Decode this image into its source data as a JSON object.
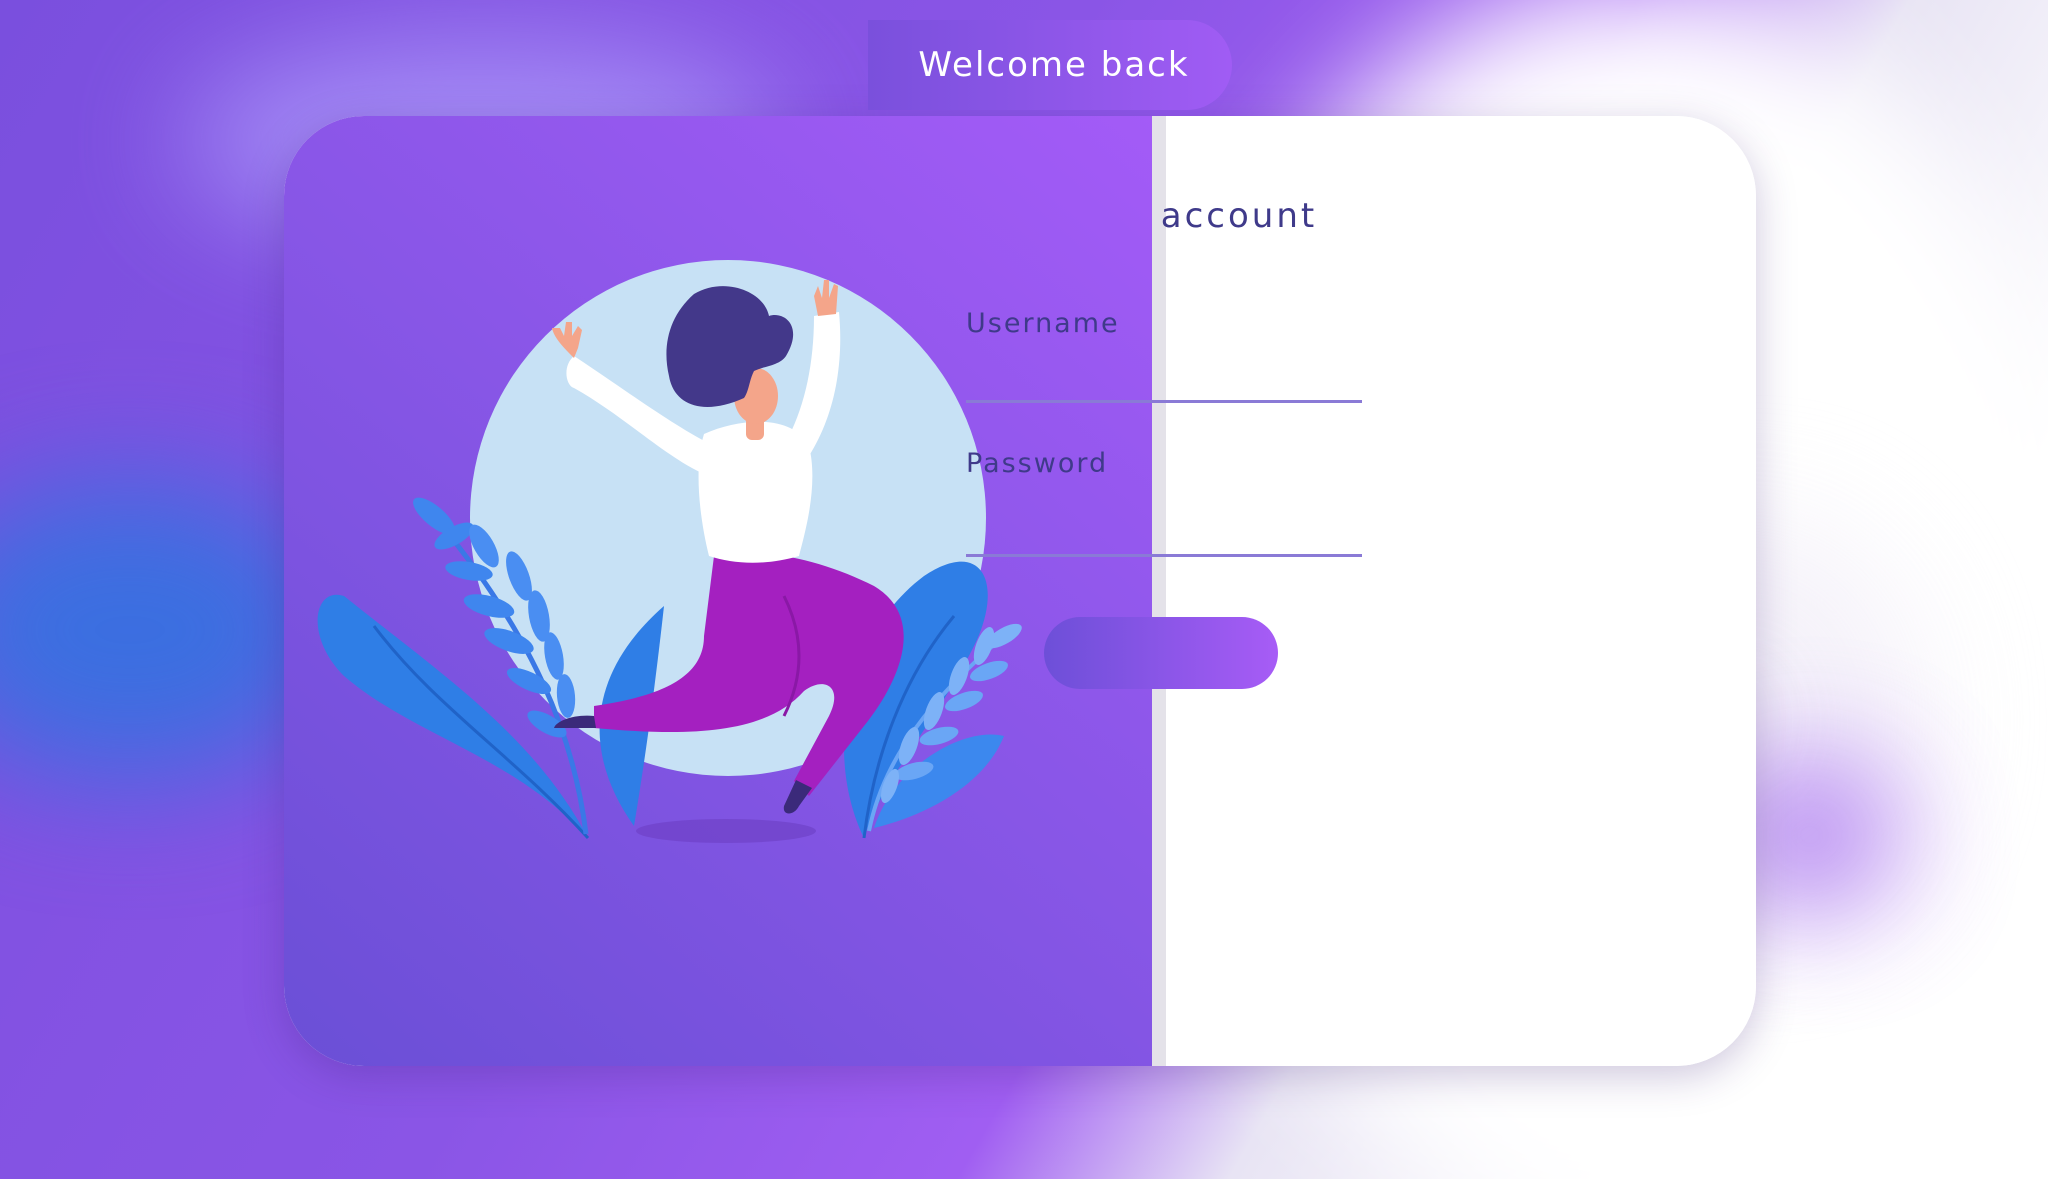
{
  "header": {
    "welcome": "Welcome back"
  },
  "form": {
    "title": "account",
    "username_label": "Username",
    "username_value": "",
    "password_label": "Password",
    "password_value": "",
    "submit_label": ""
  },
  "colors": {
    "accent_start": "#6d4fd8",
    "accent_end": "#a75cf6",
    "text": "#3f3a8a",
    "underline": "#8a7ad6"
  },
  "illustration": {
    "icon": "woman-jumping-with-plants-illustration"
  }
}
